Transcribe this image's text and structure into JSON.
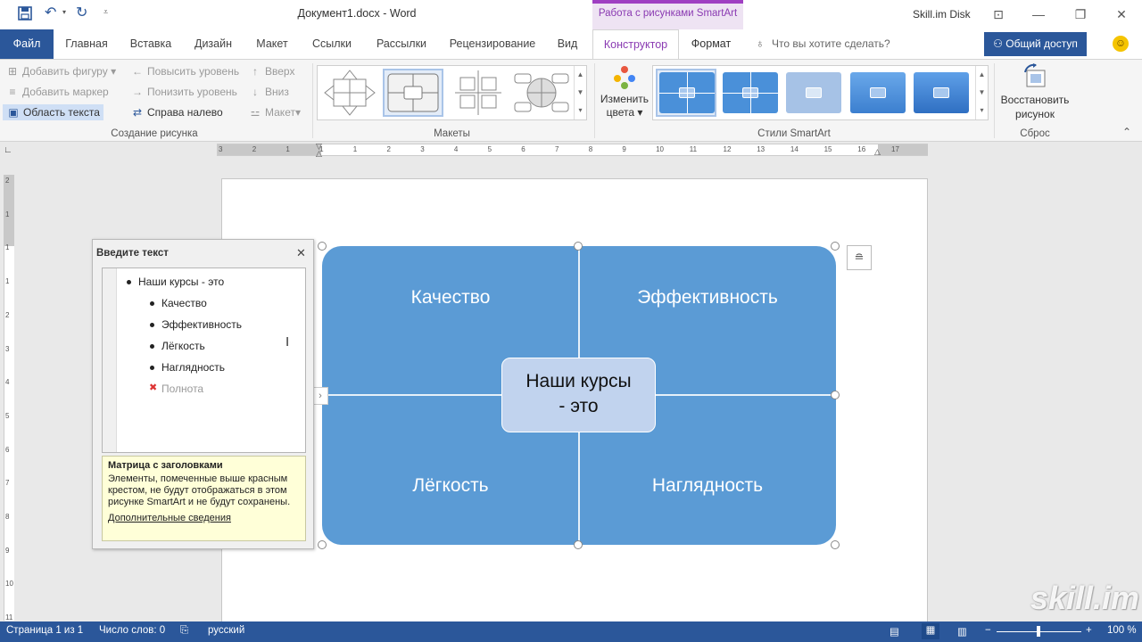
{
  "title_bar": {
    "doc_title": "Документ1.docx - Word",
    "context_tab_group": "Работа с рисунками SmartArt",
    "skill_disk": "Skill.im Disk",
    "undo_icon": "undo-icon",
    "redo_icon": "redo-icon"
  },
  "tabs": {
    "file": "Файл",
    "home": "Главная",
    "insert": "Вставка",
    "design": "Дизайн",
    "layout": "Макет",
    "refs": "Ссылки",
    "mailings": "Рассылки",
    "review": "Рецензирование",
    "view": "Вид",
    "construct": "Конструктор",
    "format": "Формат",
    "tellme": "Что вы хотите сделать?",
    "share": "Общий доступ"
  },
  "ribbon": {
    "add_shape": "Добавить фигуру",
    "add_bullet": "Добавить маркер",
    "text_pane": "Область текста",
    "promote": "Повысить уровень",
    "demote": "Понизить уровень",
    "rtl": "Справа налево",
    "move_up": "Вверх",
    "move_down": "Вниз",
    "layout": "Макет",
    "group_create": "Создание рисунка",
    "group_layouts": "Макеты",
    "change_colors_1": "Изменить",
    "change_colors_2": "цвета",
    "group_styles": "Стили SmartArt",
    "reset_1": "Восстановить",
    "reset_2": "рисунок",
    "group_reset": "Сброс"
  },
  "ruler": {
    "numbers": [
      "3",
      "2",
      "1",
      "1",
      "1",
      "2",
      "3",
      "4",
      "5",
      "6",
      "7",
      "8",
      "9",
      "10",
      "11",
      "12",
      "13",
      "14",
      "15",
      "16",
      "17"
    ],
    "vertical": [
      "2",
      "1",
      "1",
      "1",
      "2",
      "3",
      "4",
      "5",
      "6",
      "7",
      "8",
      "9",
      "10",
      "11"
    ]
  },
  "text_pane": {
    "title": "Введите текст",
    "items": [
      {
        "text": "Наши курсы - это",
        "level": 1
      },
      {
        "text": "Качество",
        "level": 2
      },
      {
        "text": "Эффективность",
        "level": 2
      },
      {
        "text": "Лёгкость",
        "level": 2
      },
      {
        "text": "Наглядность",
        "level": 2
      },
      {
        "text": "Полнота",
        "level": 2,
        "hidden": true
      }
    ],
    "info_title": "Матрица с заголовками",
    "info_text": "Элементы, помеченные выше красным крестом, не будут отображаться в этом рисунке SmartArt и не будут сохранены.",
    "info_link": "Дополнительные сведения"
  },
  "smartart": {
    "q1": "Качество",
    "q2": "Эффективность",
    "q3": "Лёгкость",
    "q4": "Наглядность",
    "center_1": "Наши курсы",
    "center_2": "- это",
    "fill_color": "#5b9bd5",
    "center_color": "#c1d3ee"
  },
  "watermark": "skill.im",
  "status_bar": {
    "page": "Страница 1 из 1",
    "words": "Число слов: 0",
    "lang": "русский",
    "zoom": "100 %"
  }
}
